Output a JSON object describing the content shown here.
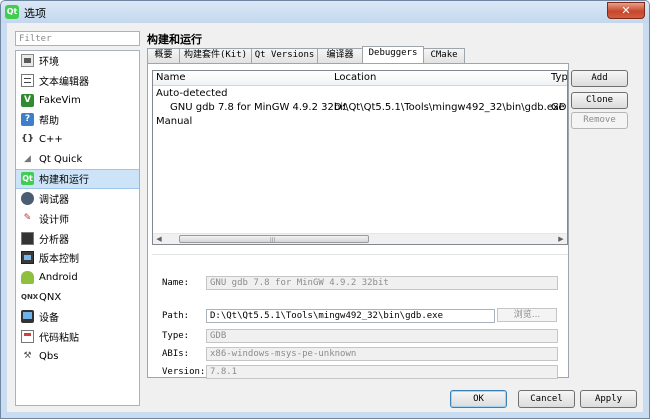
{
  "window": {
    "title": "选项",
    "app_icon": "Qt",
    "close_glyph": "✕"
  },
  "filter": {
    "placeholder": "Filter"
  },
  "sidebar": {
    "items": [
      {
        "label": "环境",
        "icon": "environment-icon"
      },
      {
        "label": "文本编辑器",
        "icon": "text-editor-icon"
      },
      {
        "label": "FakeVim",
        "icon": "fakevim-icon"
      },
      {
        "label": "帮助",
        "icon": "help-icon"
      },
      {
        "label": "C++",
        "icon": "cpp-icon"
      },
      {
        "label": "Qt Quick",
        "icon": "qt-quick-icon"
      },
      {
        "label": "构建和运行",
        "icon": "build-run-icon"
      },
      {
        "label": "调试器",
        "icon": "debugger-icon"
      },
      {
        "label": "设计师",
        "icon": "designer-icon"
      },
      {
        "label": "分析器",
        "icon": "analyzer-icon"
      },
      {
        "label": "版本控制",
        "icon": "version-control-icon"
      },
      {
        "label": "Android",
        "icon": "android-icon"
      },
      {
        "label": "QNX",
        "icon": "qnx-icon"
      },
      {
        "label": "设备",
        "icon": "devices-icon"
      },
      {
        "label": "代码粘贴",
        "icon": "code-paste-icon"
      },
      {
        "label": "Qbs",
        "icon": "qbs-icon"
      }
    ],
    "selected": "构建和运行"
  },
  "page": {
    "title": "构建和运行"
  },
  "tabs": [
    {
      "label": "概要"
    },
    {
      "label": "构建套件(Kit)"
    },
    {
      "label": "Qt Versions"
    },
    {
      "label": "编译器"
    },
    {
      "label": "Debuggers"
    },
    {
      "label": "CMake"
    }
  ],
  "active_tab": "Debuggers",
  "tree": {
    "columns": [
      "Name",
      "Location",
      "Type"
    ],
    "groups": [
      {
        "label": "Auto-detected",
        "rows": [
          {
            "name": "GNU gdb 7.8 for MinGW 4.9.2 32bit",
            "location": "D:\\Qt\\Qt5.5.1\\Tools\\mingw492_32\\bin\\gdb.exe",
            "type": "GDB"
          }
        ]
      },
      {
        "label": "Manual",
        "rows": []
      }
    ]
  },
  "details": {
    "name_label": "Name:",
    "name_value": "GNU gdb 7.8 for MinGW 4.9.2 32bit",
    "path_label": "Path:",
    "path_value": "D:\\Qt\\Qt5.5.1\\Tools\\mingw492_32\\bin\\gdb.exe",
    "browse_label": "浏览...",
    "type_label": "Type:",
    "type_value": "GDB",
    "abis_label": "ABIs:",
    "abis_value": "x86-windows-msys-pe-unknown",
    "version_label": "Version:",
    "version_value": "7.8.1"
  },
  "side_buttons": {
    "add": "Add",
    "clone": "Clone",
    "remove": "Remove"
  },
  "footer": {
    "ok": "OK",
    "cancel": "Cancel",
    "apply": "Apply"
  }
}
